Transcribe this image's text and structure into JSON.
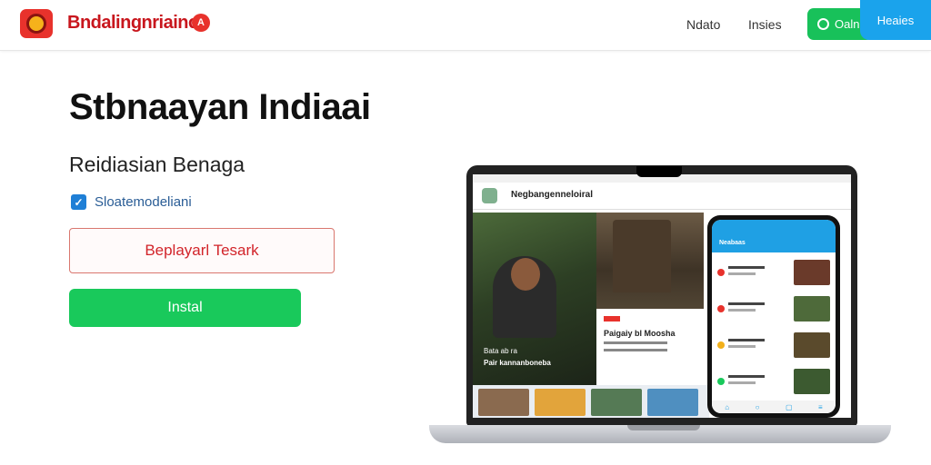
{
  "header": {
    "brand_name": "Bndalingnriainci",
    "brand_badge": "A",
    "nav": [
      "Ndato",
      "Insies"
    ],
    "search_button": "Oalnn",
    "blue_button": "Heaies"
  },
  "hero": {
    "title": "Stbnaayan Indiaai",
    "subtitle": "Reidiasian Benaga",
    "checkbox_label": "Sloatemodeliani",
    "checkbox_checked": true,
    "outline_button": "Beplayarl Tesark",
    "install_button": "Instal"
  },
  "device": {
    "app_title": "Negbangenneloiral",
    "photo_caption_1": "Bata ab ra",
    "photo_caption_2": "Pair kannanboneba",
    "card_title": "Paigaiy bl Moosha",
    "phone_header": "Neabaas"
  },
  "colors": {
    "brand_red": "#c8161d",
    "install_green": "#19c95b",
    "accent_blue": "#1aa3ec"
  }
}
